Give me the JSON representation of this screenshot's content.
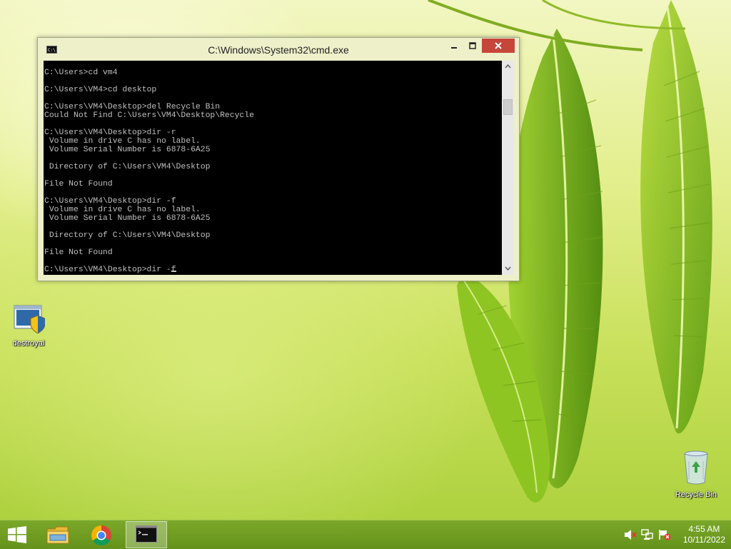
{
  "desktop": {
    "icons": [
      {
        "label": "destroyal"
      },
      {
        "label": "Recycle Bin"
      }
    ]
  },
  "window": {
    "title": "C:\\Windows\\System32\\cmd.exe",
    "icon_text": "C:\\",
    "console_lines": [
      "C:\\Users>cd vm4",
      "",
      "C:\\Users\\VM4>cd desktop",
      "",
      "C:\\Users\\VM4\\Desktop>del Recycle Bin",
      "Could Not Find C:\\Users\\VM4\\Desktop\\Recycle",
      "",
      "C:\\Users\\VM4\\Desktop>dir -r",
      " Volume in drive C has no label.",
      " Volume Serial Number is 6878-6A25",
      "",
      " Directory of C:\\Users\\VM4\\Desktop",
      "",
      "File Not Found",
      "",
      "C:\\Users\\VM4\\Desktop>dir -f",
      " Volume in drive C has no label.",
      " Volume Serial Number is 6878-6A25",
      "",
      " Directory of C:\\Users\\VM4\\Desktop",
      "",
      "File Not Found",
      "",
      "C:\\Users\\VM4\\Desktop>dir -f"
    ],
    "scrollbar_position": 0.15
  },
  "taskbar": {
    "apps": [
      {
        "name": "file-explorer-icon"
      },
      {
        "name": "chrome-icon"
      },
      {
        "name": "command-prompt-icon",
        "active": true
      }
    ],
    "clock": {
      "time": "4:55 AM",
      "date": "10/11/2022"
    }
  },
  "colors": {
    "console_bg": "#000000",
    "console_text": "#c0c0c0",
    "close_button": "#c7463a",
    "taskbar": "#6f9a22"
  }
}
